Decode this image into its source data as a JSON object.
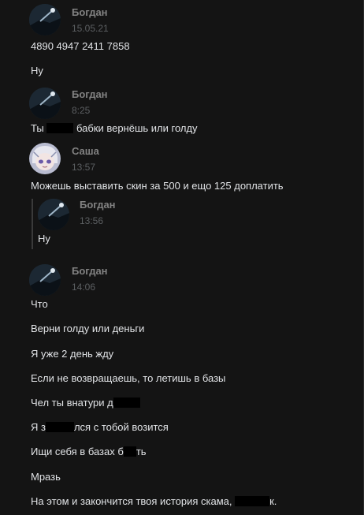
{
  "messages": [
    {
      "author": "Богдан",
      "time": "15.05.21",
      "avatar": "dark-landscape-avatar",
      "lines": [
        "4890 4947 2411 7858",
        "Ну"
      ]
    },
    {
      "author": "Богдан",
      "time": "8:25",
      "avatar": "dark-landscape-avatar",
      "line1_a": "Ты ",
      "line1_b": " бабки вернёшь или голду"
    },
    {
      "author": "Саша",
      "time": "13:57",
      "avatar": "anime-character-avatar",
      "lines": [
        "Можешь выставить скин за 500 и ещо 125 доплатить"
      ],
      "quote": {
        "author": "Богдан",
        "time": "13:56",
        "text": "Ну"
      }
    },
    {
      "author": "Богдан",
      "time": "14:06",
      "avatar": "dark-landscape-avatar",
      "lines": [
        "Что",
        "Верни голду или деньги",
        "Я уже 2 день жду",
        "Если не возвращаешь, то летишь в базы"
      ],
      "line_chel": "Чел ты внатури д",
      "line_ya_a": "Я з",
      "line_ya_b": "лся с тобой возится",
      "line_ischi_a": "Ищи себя в базах б",
      "line_ischi_b": "ть",
      "line_mraz": "Мразь",
      "line_last_a": "На этом и закончится твоя история скама, ",
      "line_last_b": "к."
    }
  ],
  "colors": {
    "background": "#141414",
    "author": "#828282",
    "time": "#5c5f62",
    "text": "#e1e3e6",
    "redaction": "#000000"
  }
}
